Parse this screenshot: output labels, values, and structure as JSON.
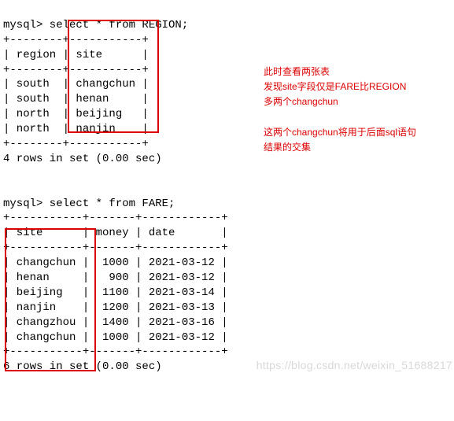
{
  "region_query": {
    "prompt": "mysql> select * from REGION;",
    "sep_top": "+--------+-----------+",
    "header_row": "| region | site      |",
    "sep_mid": "+--------+-----------+",
    "rows": [
      "| south  | changchun |",
      "| south  | henan     |",
      "| north  | beijing   |",
      "| north  | nanjin    |"
    ],
    "sep_bot": "+--------+-----------+",
    "footer": "4 rows in set (0.00 sec)"
  },
  "fare_query": {
    "prompt": "mysql> select * from FARE;",
    "sep_top": "+-----------+-------+------------+",
    "header_row": "| site      | money | date       |",
    "sep_mid": "+-----------+-------+------------+",
    "rows": [
      "| changchun |  1000 | 2021-03-12 |",
      "| henan     |   900 | 2021-03-12 |",
      "| beijing   |  1100 | 2021-03-14 |",
      "| nanjin    |  1200 | 2021-03-13 |",
      "| changzhou |  1400 | 2021-03-16 |",
      "| changchun |  1000 | 2021-03-12 |"
    ],
    "sep_bot": "+-----------+-------+------------+",
    "footer": "6 rows in set (0.00 sec)"
  },
  "annotation": {
    "l1": "此时查看两张表",
    "l2": "发现site字段仅是FARE比REGION",
    "l3": "多两个changchun",
    "l4": "这两个changchun将用于后面sql语句",
    "l5": "结果的交集"
  },
  "watermark": "https://blog.csdn.net/weixin_51688217",
  "chart_data": [
    {
      "type": "table",
      "title": "REGION",
      "columns": [
        "region",
        "site"
      ],
      "rows": [
        [
          "south",
          "changchun"
        ],
        [
          "south",
          "henan"
        ],
        [
          "north",
          "beijing"
        ],
        [
          "north",
          "nanjin"
        ]
      ]
    },
    {
      "type": "table",
      "title": "FARE",
      "columns": [
        "site",
        "money",
        "date"
      ],
      "rows": [
        [
          "changchun",
          1000,
          "2021-03-12"
        ],
        [
          "henan",
          900,
          "2021-03-12"
        ],
        [
          "beijing",
          1100,
          "2021-03-14"
        ],
        [
          "nanjin",
          1200,
          "2021-03-13"
        ],
        [
          "changzhou",
          1400,
          "2021-03-16"
        ],
        [
          "changchun",
          1000,
          "2021-03-12"
        ]
      ]
    }
  ]
}
